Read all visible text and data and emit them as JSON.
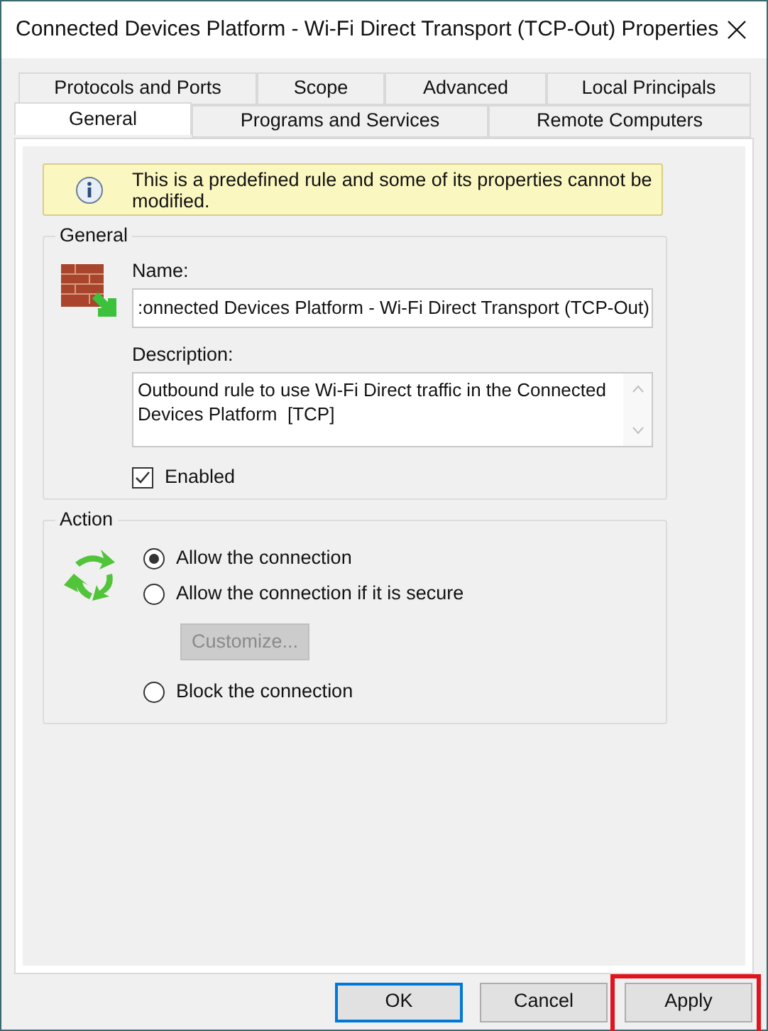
{
  "window": {
    "title": "Connected Devices Platform - Wi-Fi Direct Transport (TCP-Out) Properties"
  },
  "tab_rows": [
    {
      "tabs": [
        {
          "label": "Protocols and Ports",
          "selected": false
        },
        {
          "label": "Scope",
          "selected": false
        },
        {
          "label": "Advanced",
          "selected": false
        },
        {
          "label": "Local Principals",
          "selected": false
        }
      ]
    },
    {
      "tabs": [
        {
          "label": "General",
          "selected": true
        },
        {
          "label": "Programs and Services",
          "selected": false
        },
        {
          "label": "Remote Computers",
          "selected": false
        }
      ]
    }
  ],
  "info_banner": {
    "text": "This is a predefined rule and some of its properties cannot be modified."
  },
  "general": {
    "title": "General",
    "name_label": "Name:",
    "name_value": ":onnected Devices Platform - Wi-Fi Direct Transport (TCP-Out)",
    "description_label": "Description:",
    "description_value": "Outbound rule to use Wi-Fi Direct traffic in the Connected Devices Platform  [TCP]",
    "enabled": {
      "label": "Enabled",
      "checked": true
    }
  },
  "action": {
    "title": "Action",
    "options": [
      {
        "label": "Allow the connection",
        "selected": true,
        "kind": "radio"
      },
      {
        "label": "Allow the connection if it is secure",
        "selected": false,
        "kind": "radio"
      },
      {
        "label": "Customize...",
        "disabled": true,
        "kind": "button"
      },
      {
        "label": "Block the connection",
        "selected": false,
        "kind": "radio"
      }
    ]
  },
  "buttons": [
    {
      "label": "OK",
      "default": true,
      "highlighted": false
    },
    {
      "label": "Cancel",
      "default": false,
      "highlighted": false
    },
    {
      "label": "Apply",
      "default": false,
      "highlighted": true
    }
  ]
}
